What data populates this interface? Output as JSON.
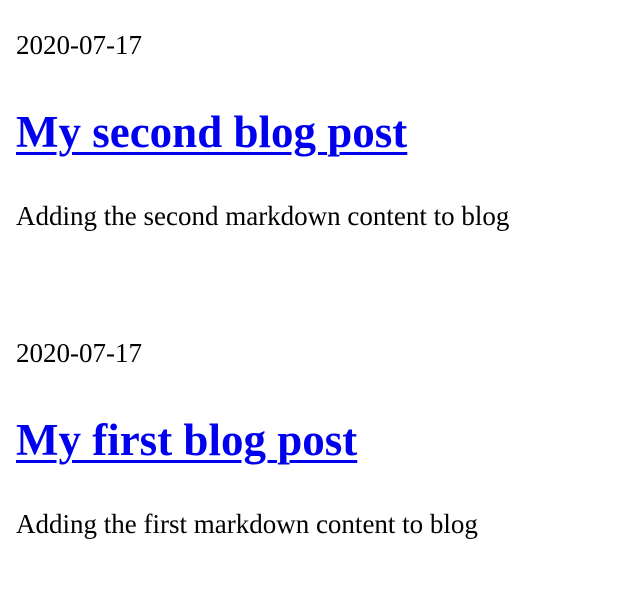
{
  "posts": [
    {
      "date": "2020-07-17",
      "title": "My second blog post",
      "excerpt": "Adding the second markdown content to blog"
    },
    {
      "date": "2020-07-17",
      "title": "My first blog post",
      "excerpt": "Adding the first markdown content to blog"
    }
  ],
  "colors": {
    "link": "#0000ee",
    "text": "#000000",
    "background": "#ffffff"
  }
}
